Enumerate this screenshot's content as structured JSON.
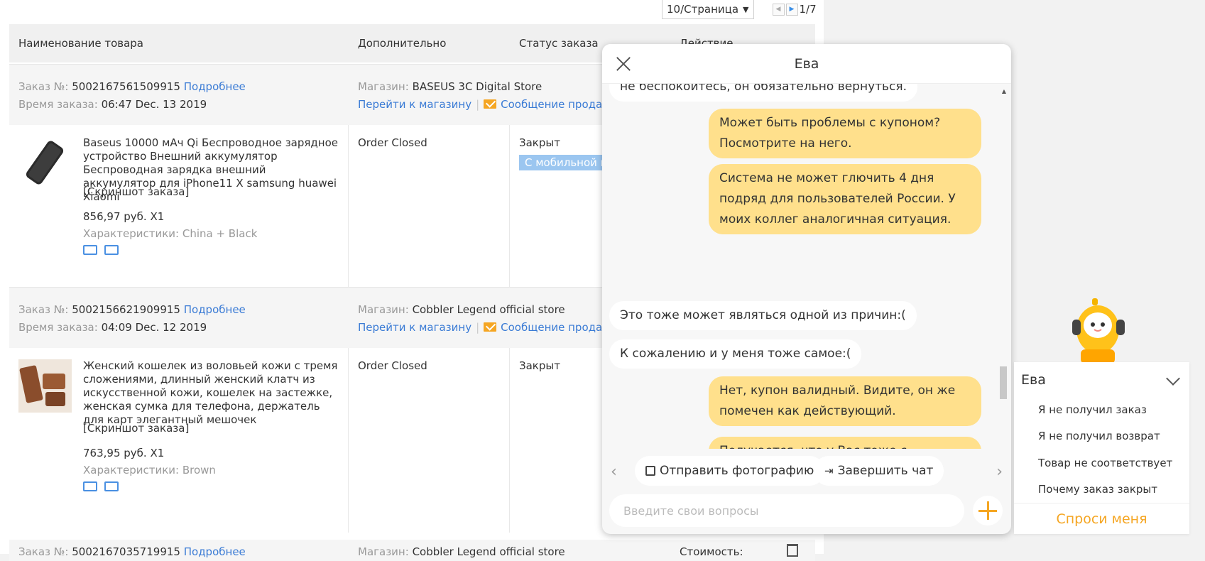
{
  "pagination": {
    "per_page": "10/Страница",
    "page_count": "1/7"
  },
  "table": {
    "headers": [
      "Наименование товара",
      "Дополнительно",
      "Статус заказа",
      "Действие"
    ]
  },
  "orders": [
    {
      "order_label": "Заказ №:",
      "order_no": "5002167561509915",
      "details_link": "Подробнее",
      "time_label": "Время заказа:",
      "time": "06:47 Dec. 13 2019",
      "store_label": "Магазин:",
      "store": "BASEUS 3C Digital Store",
      "store_link": "Перейти к магазину",
      "message_link": "Сообщение продавц",
      "product": "Baseus 10000 мАч Qi Беспроводное зарядное устройство Внешний аккумулятор Беспроводная зарядка внешний аккумулятор для iPhone11 X samsung huawei Xiaomi",
      "screenshot": "[Скриншот заказа]",
      "price": "856,97 руб. X1",
      "chars": "Характеристики: China + Black",
      "status": "Order Closed",
      "closed": "Закрыт",
      "badge": "С мобильной в"
    },
    {
      "order_label": "Заказ №:",
      "order_no": "5002156621909915",
      "details_link": "Подробнее",
      "time_label": "Время заказа:",
      "time": "04:09 Dec. 12 2019",
      "store_label": "Магазин:",
      "store": "Cobbler Legend official store",
      "store_link": "Перейти к магазину",
      "message_link": "Сообщение продавц",
      "product": "Женский кошелек из воловьей кожи с тремя сложениями, длинный женский клатч из искусственной кожи, кошелек на застежке, женская сумка для телефона, держатель для карт элегантный мешочек",
      "screenshot": "[Скриншот заказа]",
      "price": "763,95 руб. X1",
      "chars": "Характеристики: Brown",
      "status": "Order Closed",
      "closed": "Закрыт"
    }
  ],
  "partial_row": {
    "order_label": "Заказ №:",
    "order_no": "5002167035719915",
    "details_link": "Подробнее",
    "store_label": "Магазин:",
    "store": "Cobbler Legend official store",
    "cost_label": "Стоимость:"
  },
  "chat": {
    "title": "Ева",
    "messages": [
      {
        "from": "bot",
        "text": "не беспокойтесь, он обязательно вернуться."
      },
      {
        "from": "user",
        "text": "Может быть проблемы с купоном? Посмотрите на него."
      },
      {
        "from": "user",
        "text": "Система не может глючить 4 дня подряд для пользователей России. У моих коллег аналогичная ситуация."
      },
      {
        "from": "bot",
        "text": "Это тоже может являться одной из причин:("
      },
      {
        "from": "bot",
        "text": "К сожалению и у меня тоже самое:("
      },
      {
        "from": "user",
        "text": "Нет, купон валидный. Видите, он же помечен как действующий."
      },
      {
        "from": "user",
        "text": "Получается, что у Вас тоже с купонами проблема?"
      }
    ],
    "quick_actions": [
      "Отправить фотографию",
      "Завершить чат"
    ],
    "input_placeholder": "Введите свои вопросы"
  },
  "eva_widget": {
    "title": "Ева",
    "items": [
      "Я не получил заказ",
      "Я не получил возврат",
      "Товар не соответствует",
      "Почему заказ закрыт"
    ],
    "ask_button": "Спроси меня"
  }
}
